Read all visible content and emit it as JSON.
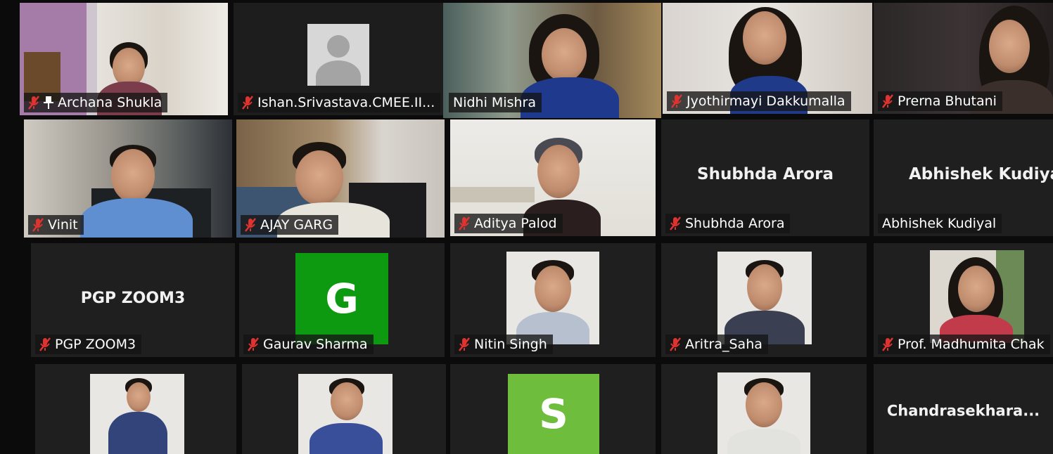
{
  "meeting": {
    "participants": [
      {
        "name": "Archana Shukla",
        "muted": true,
        "pinned": true
      },
      {
        "name": "Ishan.Srivastava.CMEE.II...",
        "muted": true
      },
      {
        "name": "Nidhi Mishra",
        "muted": false,
        "active_speaker": true
      },
      {
        "name": "Jyothirmayi Dakkumalla",
        "muted": true
      },
      {
        "name": "Prerna Bhutani",
        "muted": true
      },
      {
        "name": "Vinit",
        "muted": true
      },
      {
        "name": "AJAY GARG",
        "muted": true
      },
      {
        "name": "Aditya Palod",
        "muted": true
      },
      {
        "name": "Shubhda Arora",
        "display_text": "Shubhda Arora",
        "muted": true
      },
      {
        "name": "Abhishek Kudiyal",
        "display_text": "Abhishek Kudiyal",
        "muted": false
      },
      {
        "name": "PGP ZOOM3",
        "display_text": "PGP ZOOM3",
        "muted": true
      },
      {
        "name": "Gaurav Sharma",
        "avatar_letter": "G",
        "avatar_color": "#0e9a10",
        "muted": true
      },
      {
        "name": "Nitin Singh",
        "muted": true
      },
      {
        "name": "Aritra_Saha",
        "muted": true
      },
      {
        "name": "Prof. Madhumita Chak",
        "muted": true
      },
      {
        "name": "",
        "muted": false
      },
      {
        "name": "",
        "muted": false
      },
      {
        "name": "",
        "avatar_letter": "S",
        "avatar_color": "#6ebd3d",
        "muted": false
      },
      {
        "name": "",
        "muted": false
      },
      {
        "name": "",
        "display_text": "Chandrasekhara...",
        "muted": false
      }
    ]
  },
  "colors": {
    "active_speaker_border": "#b4d233",
    "muted_icon": "#e0332f",
    "tile_background": "#1f1f20"
  }
}
